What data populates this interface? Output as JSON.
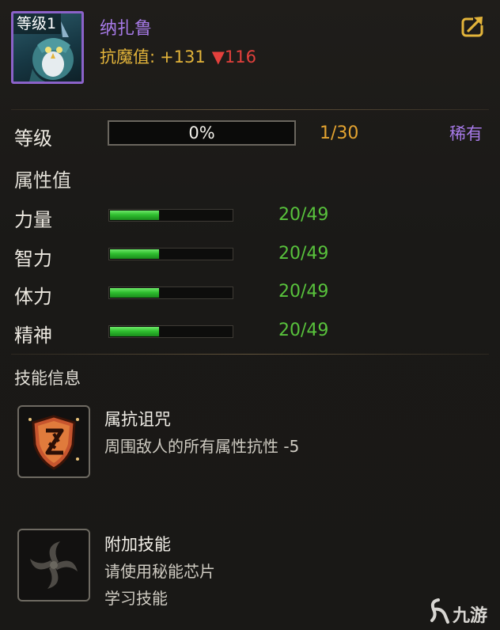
{
  "header": {
    "level_tag": "等级1",
    "pet_name": "纳扎鲁",
    "resist_label": "抗魔值:",
    "resist_plus": "+131",
    "resist_minus": "▼116",
    "share_icon": "share-export-icon"
  },
  "level": {
    "label": "等级",
    "progress_text": "0%",
    "progress_fraction": 0.0,
    "count": "1/30",
    "rarity": "稀有"
  },
  "attributes": {
    "title": "属性值",
    "items": [
      {
        "label": "力量",
        "value": "20/49",
        "fraction": 0.408
      },
      {
        "label": "智力",
        "value": "20/49",
        "fraction": 0.408
      },
      {
        "label": "体力",
        "value": "20/49",
        "fraction": 0.408
      },
      {
        "label": "精神",
        "value": "20/49",
        "fraction": 0.408
      }
    ]
  },
  "skills": {
    "title": "技能信息",
    "items": [
      {
        "icon": "cursed-shield-icon",
        "name": "属抗诅咒",
        "desc_lines": [
          "周围敌人的所有属性抗性 -5"
        ]
      },
      {
        "icon": "spiral-blades-icon",
        "name": "附加技能",
        "desc_lines": [
          "请使用秘能芯片",
          "学习技能"
        ]
      }
    ]
  },
  "watermark": {
    "text": "九游"
  },
  "colors": {
    "accent_purple": "#a77ae8",
    "gold": "#e3b43a",
    "red": "#e3403c",
    "orange": "#e3a330",
    "green": "#58c23c"
  }
}
